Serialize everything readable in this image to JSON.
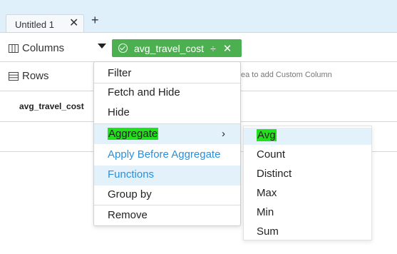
{
  "tab": {
    "label": "Untitled 1",
    "close": "✕",
    "add": "+"
  },
  "shelves": {
    "columns_label": "Columns",
    "rows_label": "Rows",
    "hint": "ea to add Custom Column"
  },
  "pill": {
    "label": "avg_travel_cost",
    "sort_glyph": "÷",
    "close_glyph": "✕"
  },
  "table": {
    "header": "avg_travel_cost"
  },
  "context_menu": {
    "items": [
      "Filter",
      "Fetch and Hide",
      "Hide",
      "Aggregate",
      "Apply Before Aggregate",
      "Functions",
      "Group by",
      "Remove"
    ],
    "submenu_chevron": "›"
  },
  "aggregate_submenu": {
    "items": [
      "Avg",
      "Count",
      "Distinct",
      "Max",
      "Min",
      "Sum"
    ]
  },
  "colors": {
    "topbar": "#dff0fb",
    "pill": "#4caf50",
    "highlight_green": "#22e01c",
    "link_blue": "#2d8ed8",
    "hover_blue": "#e3f1fb"
  }
}
